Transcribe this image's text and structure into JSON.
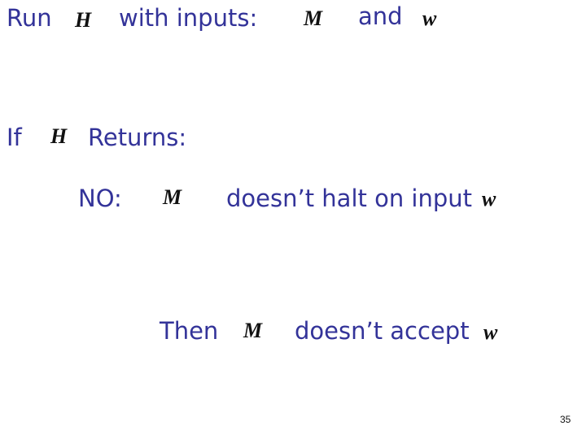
{
  "slide": {
    "line1": {
      "run": "Run",
      "h": "H",
      "with_inputs": "with inputs:",
      "m": "M",
      "and": "and",
      "w": "w"
    },
    "line2": {
      "if": "If",
      "h": "H",
      "returns": "Returns:"
    },
    "line3": {
      "no": "NO:",
      "m": "M",
      "text": "doesn’t halt on input",
      "w": "w"
    },
    "line4": {
      "then": "Then",
      "m": "M",
      "text": "doesn’t accept",
      "w": "w"
    },
    "page_number": "35"
  }
}
